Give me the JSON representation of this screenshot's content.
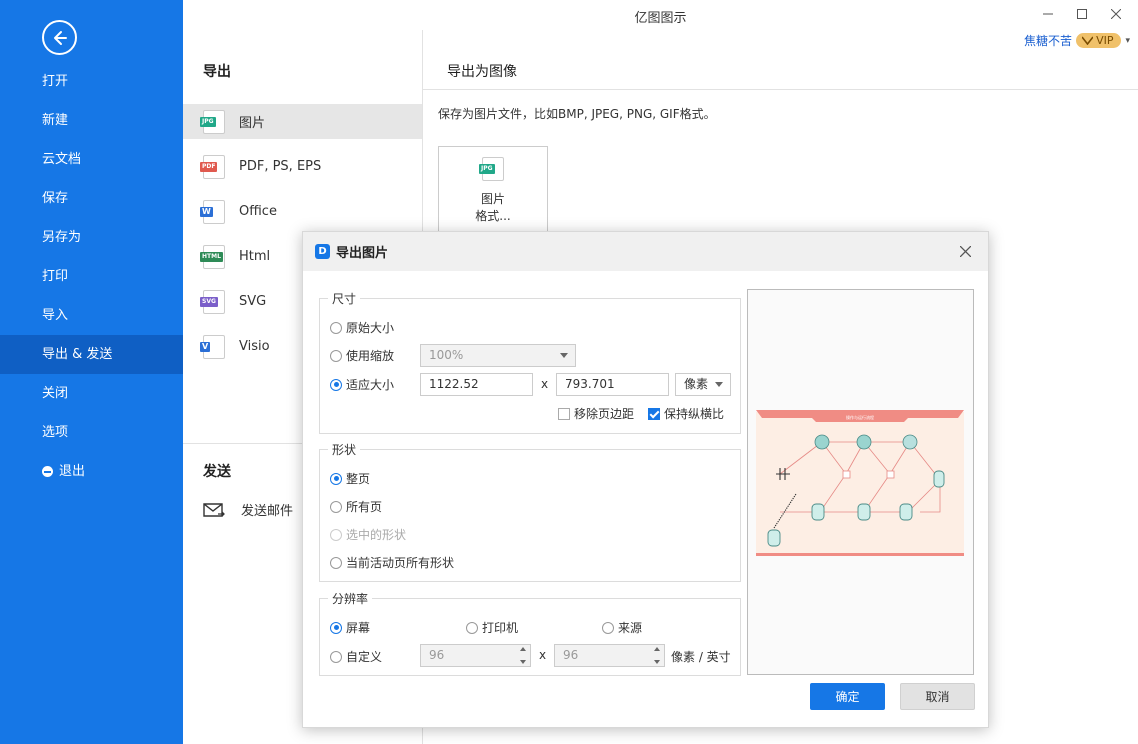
{
  "app": {
    "title": "亿图图示"
  },
  "user": {
    "name": "焦糖不苦",
    "badge": "VIP"
  },
  "sidebar": {
    "items": [
      {
        "label": "打开"
      },
      {
        "label": "新建"
      },
      {
        "label": "云文档"
      },
      {
        "label": "保存"
      },
      {
        "label": "另存为"
      },
      {
        "label": "打印"
      },
      {
        "label": "导入"
      },
      {
        "label": "导出 & 发送"
      },
      {
        "label": "关闭"
      },
      {
        "label": "选项"
      },
      {
        "label": "退出"
      }
    ],
    "active_index": 7
  },
  "export_panel": {
    "heading": "导出",
    "items": [
      {
        "label": "图片",
        "tag": "JPG",
        "color": "#21a889"
      },
      {
        "label": "PDF, PS, EPS",
        "tag": "PDF",
        "color": "#e05a4f"
      },
      {
        "label": "Office",
        "tag": "W",
        "color": "#2b6fd6"
      },
      {
        "label": "Html",
        "tag": "HTML",
        "color": "#2e8b57"
      },
      {
        "label": "SVG",
        "tag": "SVG",
        "color": "#7b5fc9"
      },
      {
        "label": "Visio",
        "tag": "V",
        "color": "#2b6fd6"
      }
    ],
    "send_heading": "发送",
    "send_mail": "发送邮件"
  },
  "right_panel": {
    "heading": "导出为图像",
    "description": "保存为图片文件，比如BMP, JPEG, PNG, GIF格式。",
    "card_tag": "JPG",
    "card_line1": "图片",
    "card_line2": "格式..."
  },
  "dialog": {
    "title": "导出图片",
    "logo": "D",
    "size": {
      "title": "尺寸",
      "original": "原始大小",
      "use_zoom": "使用缩放",
      "zoom_value": "100%",
      "fit": "适应大小",
      "width": "1122.52",
      "x": "x",
      "height": "793.701",
      "unit": "像素",
      "remove_margin": "移除页边距",
      "keep_ratio": "保持纵横比"
    },
    "shape": {
      "title": "形状",
      "whole_page": "整页",
      "all_pages": "所有页",
      "selected": "选中的形状",
      "active_page_all": "当前活动页所有形状"
    },
    "resolution": {
      "title": "分辨率",
      "screen": "屏幕",
      "printer": "打印机",
      "source": "来源",
      "custom": "自定义",
      "dpi_x": "96",
      "x": "x",
      "dpi_y": "96",
      "unit": "像素 / 英寸"
    },
    "preview_title": "操作与运行流程",
    "ok": "确定",
    "cancel": "取消"
  }
}
